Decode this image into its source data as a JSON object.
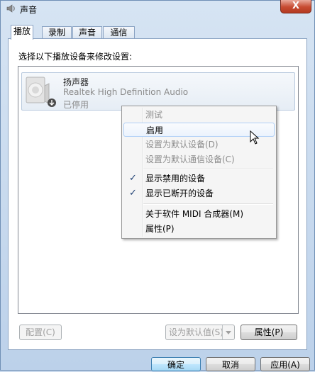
{
  "window": {
    "title": "声音",
    "close_label": "X"
  },
  "tabs": [
    {
      "label": "播放",
      "active": true
    },
    {
      "label": "录制",
      "active": false
    },
    {
      "label": "声音",
      "active": false
    },
    {
      "label": "通信",
      "active": false
    }
  ],
  "instruction": "选择以下播放设备来修改设置:",
  "device": {
    "name": "扬声器",
    "driver": "Realtek High Definition Audio",
    "status": "已停用",
    "icon": "speaker-icon"
  },
  "context_menu": {
    "items": [
      {
        "label": "测试",
        "enabled": false,
        "checked": false
      },
      {
        "label": "启用",
        "enabled": true,
        "checked": false,
        "highlighted": true
      },
      {
        "label": "设置为默认设备(D)",
        "enabled": false,
        "checked": false
      },
      {
        "label": "设置为默认通信设备(C)",
        "enabled": false,
        "checked": false
      },
      {
        "label": "显示禁用的设备",
        "enabled": true,
        "checked": true
      },
      {
        "label": "显示已断开的设备",
        "enabled": true,
        "checked": true
      },
      {
        "label": "关于软件 MIDI 合成器(M)",
        "enabled": true,
        "checked": false
      },
      {
        "label": "属性(P)",
        "enabled": true,
        "checked": false
      }
    ]
  },
  "buttons": {
    "configure": "配置(C)",
    "set_default": "设为默认值(S)",
    "properties": "属性(P)",
    "ok": "确定",
    "cancel": "取消",
    "apply": "应用(A)"
  },
  "colors": {
    "accent": "#3c7fb1",
    "close": "#c74b31"
  }
}
